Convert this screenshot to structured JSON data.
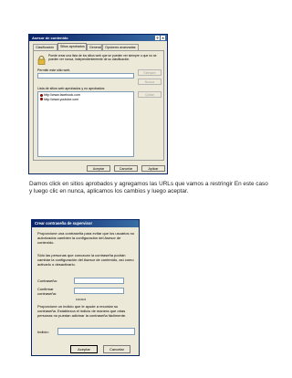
{
  "window1": {
    "title": "Asesor de contenido",
    "controls": {
      "help": "?",
      "close": "×"
    },
    "tabs": [
      "Clasificación",
      "Sitios aprobados",
      "General",
      "Opciones avanzadas"
    ],
    "info_text": "Puede crear una lista de los sitios web que se pueden ver siempre o que no se pueden ver nunca, independientemente de su clasificación.",
    "site_label": "Permitir este sitio web:",
    "site_value": "",
    "buttons": {
      "always": "Siempre",
      "never": "Nunca",
      "remove": "Quitar"
    },
    "list_label": "Lista de sitios web aprobados y no aprobados:",
    "list_items": [
      "http://www.facebook.com",
      "http://www.youtube.com"
    ],
    "footer_buttons": {
      "ok": "Aceptar",
      "cancel": "Cancelar",
      "apply": "Aplicar"
    },
    "colors": {
      "blocked": "#d81e05"
    }
  },
  "caption": "Damos click en sitios aprobados y agregamos las URLs que vamos a restringir En este caso y luego clic en nunca, aplicamos los cambios y luego aceptar.",
  "window2": {
    "title": "Crear contraseña de supervisor",
    "paragraph1": "Proporcione una contraseña para evitar que los usuarios no autorizados cambien la configuración del Asesor de contenido.",
    "paragraph2": "Sólo las personas que conozcan la contraseña podrán cambiar la configuración del Asesor de contenido, así como activarlo o desactivarlo.",
    "password_label": "Contraseña:",
    "password_value": "••••••••",
    "confirm_label": "Confirmar contraseña:",
    "confirm_value": "••••••••",
    "paragraph3": "Proporcione un indicio que le ayude a recordar su contraseña. Establezca el indicio de manera que otras personas no puedan adivinar la contraseña fácilmente.",
    "hint_label": "Indicio:",
    "hint_value": "",
    "footer_buttons": {
      "ok": "Aceptar",
      "cancel": "Cancelar"
    }
  }
}
